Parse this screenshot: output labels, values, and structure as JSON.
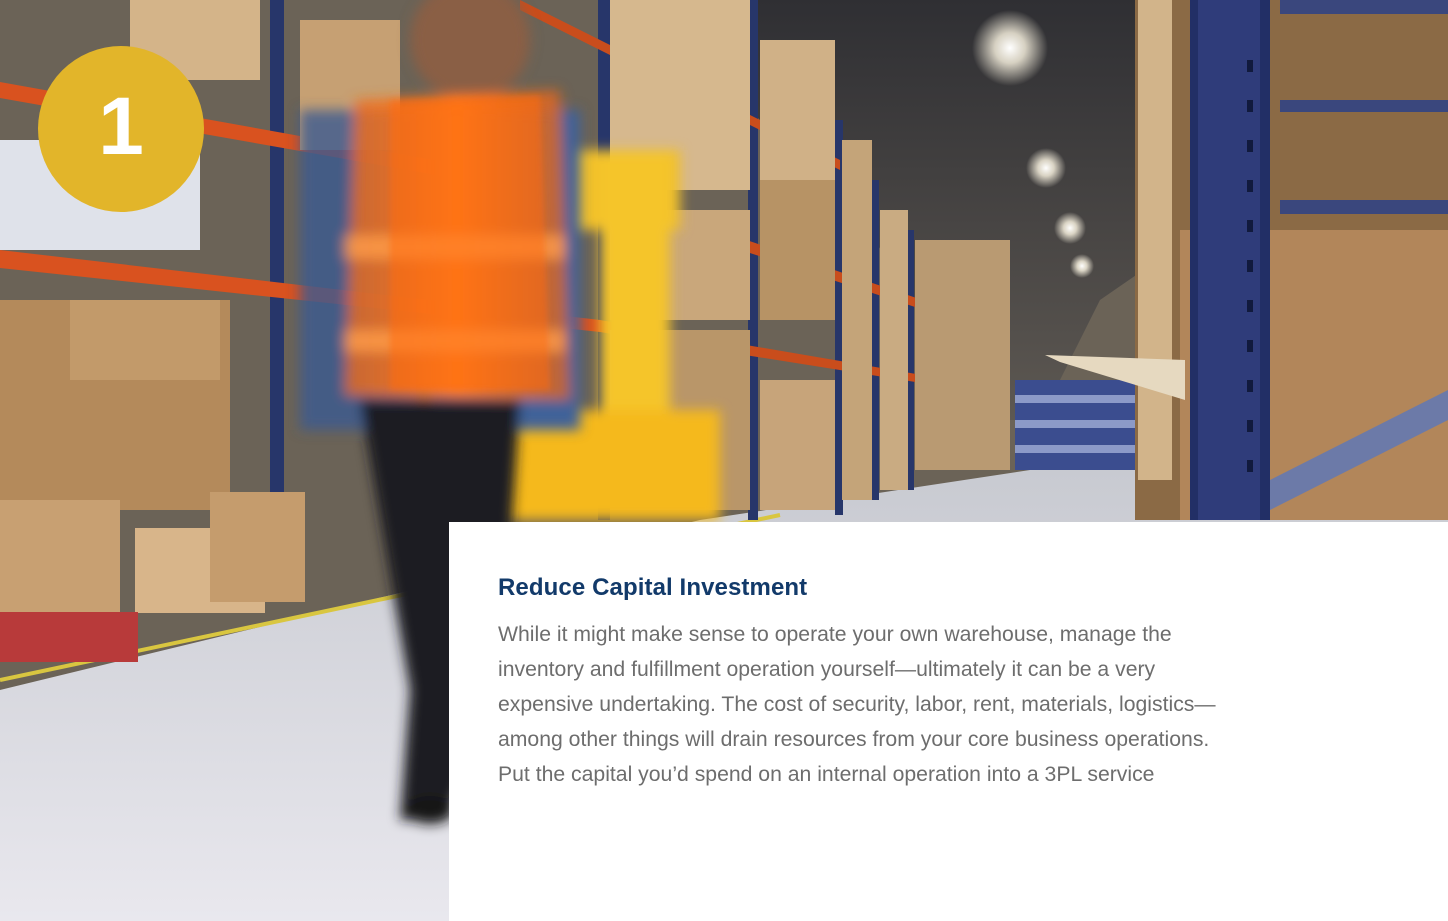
{
  "badge": {
    "number": "1",
    "color": "#e2b52a"
  },
  "panel": {
    "heading": "Reduce Capital Investment",
    "heading_color": "#123a6a",
    "body_lines": [
      "While it might make sense to operate your own warehouse, manage the",
      "inventory and fulfillment operation yourself—ultimately it can be a very",
      "expensive undertaking. The cost of security, labor, rent, materials, logistics—",
      "among other things will drain resources from your core business operations.",
      "Put the capital you’d spend on an internal operation into a 3PL service"
    ]
  }
}
